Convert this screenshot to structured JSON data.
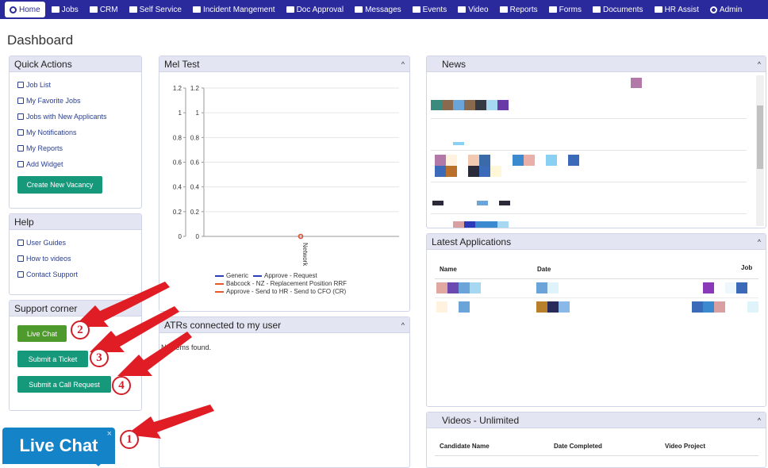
{
  "nav": {
    "items": [
      {
        "label": "Home",
        "active": true,
        "icon": "home-icon"
      },
      {
        "label": "Jobs",
        "icon": "folder-icon"
      },
      {
        "label": "CRM",
        "icon": "briefcase-icon"
      },
      {
        "label": "Self Service",
        "icon": "list-icon"
      },
      {
        "label": "Incident Mangement",
        "icon": "list-icon"
      },
      {
        "label": "Doc Approval",
        "icon": "list-icon"
      },
      {
        "label": "Messages",
        "icon": "envelope-icon"
      },
      {
        "label": "Events",
        "icon": "calendar-icon"
      },
      {
        "label": "Video",
        "icon": "video-icon"
      },
      {
        "label": "Reports",
        "icon": "report-icon"
      },
      {
        "label": "Forms",
        "icon": "file-icon"
      },
      {
        "label": "Documents",
        "icon": "filter-icon"
      },
      {
        "label": "HR Assist",
        "icon": "briefcase-icon"
      },
      {
        "label": "Admin",
        "icon": "gear-icon"
      }
    ]
  },
  "page": {
    "title": "Dashboard"
  },
  "quick_actions": {
    "title": "Quick Actions",
    "items": [
      {
        "label": "Job List",
        "icon": "list-icon"
      },
      {
        "label": "My Favorite Jobs",
        "icon": "copy-icon"
      },
      {
        "label": "Jobs with New Applicants",
        "icon": "file-icon"
      },
      {
        "label": "My Notifications",
        "icon": "envelope-icon"
      },
      {
        "label": "My Reports",
        "icon": "folder-open-icon"
      },
      {
        "label": "Add Widget",
        "icon": "bar-chart-icon"
      }
    ],
    "button": "Create New Vacancy"
  },
  "help": {
    "title": "Help",
    "items": [
      {
        "label": "User Guides",
        "icon": "copy-icon"
      },
      {
        "label": "How to videos",
        "icon": "video-icon"
      },
      {
        "label": "Contact Support",
        "icon": "phone-icon"
      }
    ]
  },
  "support": {
    "title": "Support corner",
    "live_chat": "Live Chat",
    "ticket": "Submit a Ticket",
    "call": "Submit a Call Request"
  },
  "mel_test": {
    "title": "Mel Test",
    "collapse": "^"
  },
  "chart_data": {
    "type": "line",
    "title": "Mel Test",
    "categories": [
      "Network"
    ],
    "ylim": [
      0,
      1.2
    ],
    "yticks": [
      "1.2",
      "1",
      "0.8",
      "0.6",
      "0.4",
      "0.2",
      "0"
    ],
    "series": [
      {
        "name": "Generic",
        "values": [
          0
        ],
        "color": "#2a3fbf"
      },
      {
        "name": "Approve - Request",
        "values": [
          0
        ],
        "color": "#2a3fbf"
      },
      {
        "name": "Babcock - NZ - Replacement Position RRF",
        "values": [
          0
        ],
        "color": "#e8552a"
      },
      {
        "name": "Approve - Send to HR - Send to CFO (CR)",
        "values": [
          0
        ],
        "color": "#e8552a"
      }
    ],
    "grid": true,
    "legend": "bottom"
  },
  "atrs": {
    "title": "ATRs connected to my user",
    "empty": "No items found."
  },
  "news": {
    "title": "News",
    "collapse": "^"
  },
  "latest_apps": {
    "title": "Latest Applications",
    "collapse": "^",
    "columns": [
      "Name",
      "Date",
      "Job"
    ]
  },
  "videos": {
    "title": "Videos - Unlimited",
    "collapse": "^",
    "columns": [
      "Candidate Name",
      "Date Completed",
      "Video Project"
    ]
  },
  "live_chat_widget": {
    "label": "Live Chat",
    "close": "×"
  },
  "annotations": {
    "badges": [
      "1",
      "2",
      "3",
      "4"
    ],
    "color": "#d0202a"
  }
}
